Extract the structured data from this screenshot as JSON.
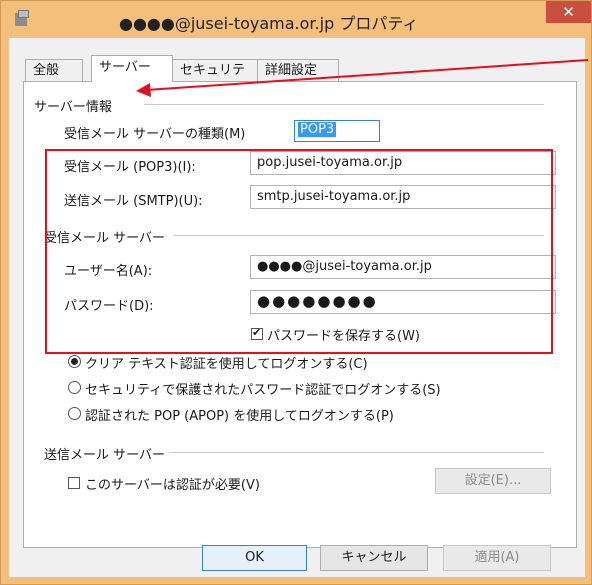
{
  "window": {
    "title": "●●●●@jusei-toyama.or.jp プロパティ",
    "close_glyph": "✕"
  },
  "tabs": [
    {
      "label": "全般",
      "selected": false
    },
    {
      "label": "サーバー",
      "selected": true
    },
    {
      "label": "セキュリティ",
      "selected": false
    },
    {
      "label": "詳細設定",
      "selected": false
    }
  ],
  "server_info": {
    "title": "サーバー情報",
    "type_label": "受信メール サーバーの種類(M)",
    "type_value": "POP3",
    "incoming_label": "受信メール (POP3)(I):",
    "incoming_value": "pop.jusei-toyama.or.jp",
    "outgoing_label": "送信メール (SMTP)(U):",
    "outgoing_value": "smtp.jusei-toyama.or.jp"
  },
  "incoming_server": {
    "title": "受信メール サーバー",
    "username_label": "ユーザー名(A):",
    "username_value": "●●●●@jusei-toyama.or.jp",
    "password_label": "パスワード(D):",
    "password_value": "●●●●●●●●",
    "save_password_label": "パスワードを保存する(W)",
    "save_password_checked": true,
    "auth_options": [
      {
        "label": "クリア テキスト認証を使用してログオンする(C)",
        "selected": true
      },
      {
        "label": "セキュリティで保護されたパスワード認証でログオンする(S)",
        "selected": false
      },
      {
        "label": "認証された POP (APOP) を使用してログオンする(P)",
        "selected": false
      }
    ]
  },
  "outgoing_server": {
    "title": "送信メール サーバー",
    "auth_required_label": "このサーバーは認証が必要(V)",
    "auth_required_checked": false,
    "settings_button": "設定(E)..."
  },
  "footer": {
    "ok": "OK",
    "cancel": "キャンセル",
    "apply": "適用(A)"
  },
  "colors": {
    "window_frame": "#f3bf7b",
    "close_button": "#c94f3f",
    "annotation_red": "#e3101d",
    "selection_blue": "#3399ff"
  }
}
